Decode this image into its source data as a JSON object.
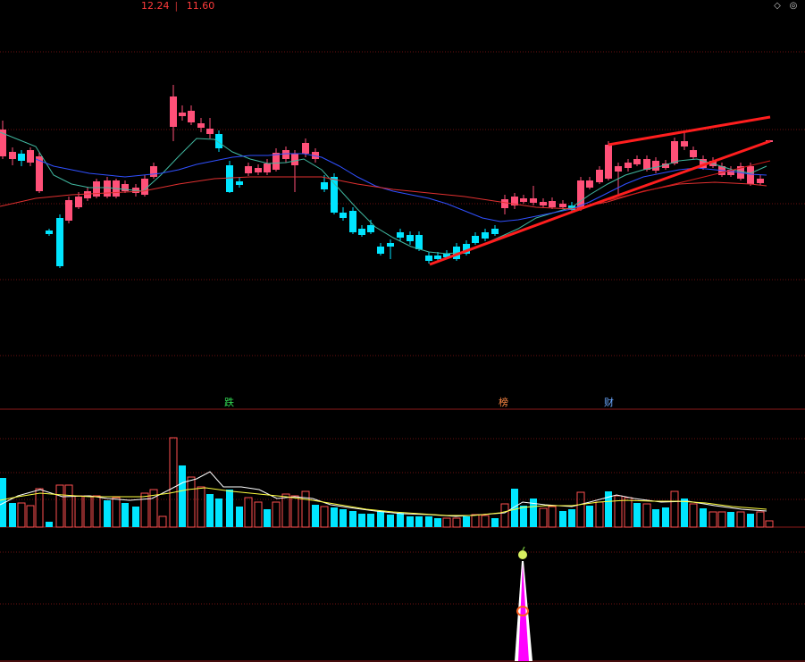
{
  "header": {
    "price_high": "12.24",
    "separator": "|",
    "price_low": "11.60"
  },
  "window_controls": {
    "restore_icon": "diamond-icon",
    "menu_icon": "circle-menu-icon"
  },
  "event_tags": [
    {
      "text": "跌",
      "color": "#33dd55"
    },
    {
      "text": "榜",
      "color": "#ff8844"
    },
    {
      "text": "财",
      "color": "#6aa8ff"
    }
  ],
  "colors": {
    "background": "#000000",
    "up_candle": "#ff5078",
    "down_candle": "#00e5ff",
    "panel_divider": "#8b1a1a",
    "grid_dotted": "#6b1010",
    "trend_line": "#ff1e1e",
    "ma_short": "#40b8a0",
    "ma_mid": "#3050ff",
    "ma_long": "#e03030",
    "vol_avg_1": "#ffffff",
    "vol_avg_2": "#ffff40",
    "signal_fill": "#ff00ff"
  },
  "signal_icons": {
    "top_icon": "apple-icon",
    "mid_icon": "coin-icon"
  }
}
